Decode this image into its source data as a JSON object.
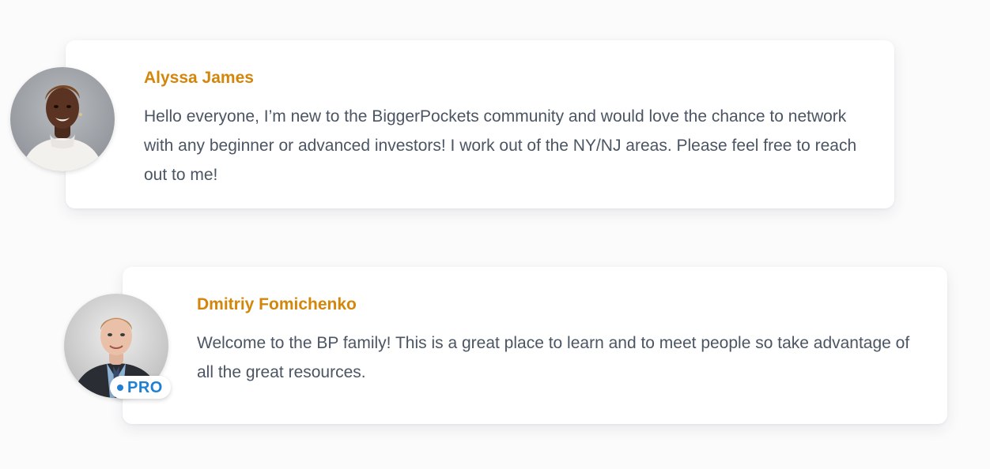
{
  "colors": {
    "background": "#fbfbfc",
    "card": "#ffffff",
    "name_accent": "#d4860b",
    "body_text": "#4b5563",
    "pro_accent": "#1f7fd3"
  },
  "comments": [
    {
      "author": "Alyssa James",
      "avatar_icon": "user-photo-avatar",
      "text": "Hello everyone, I’m new to the BiggerPockets community and would love the chance to network with any beginner or advanced investors! I work out of the NY/NJ areas. Please feel free to reach out to me!"
    },
    {
      "author": "Dmitriy Fomichenko",
      "avatar_icon": "user-photo-avatar",
      "badge": "PRO",
      "text": "Welcome to the BP family! This is a great place to learn and to meet people so take advantage of all the great resources."
    }
  ]
}
